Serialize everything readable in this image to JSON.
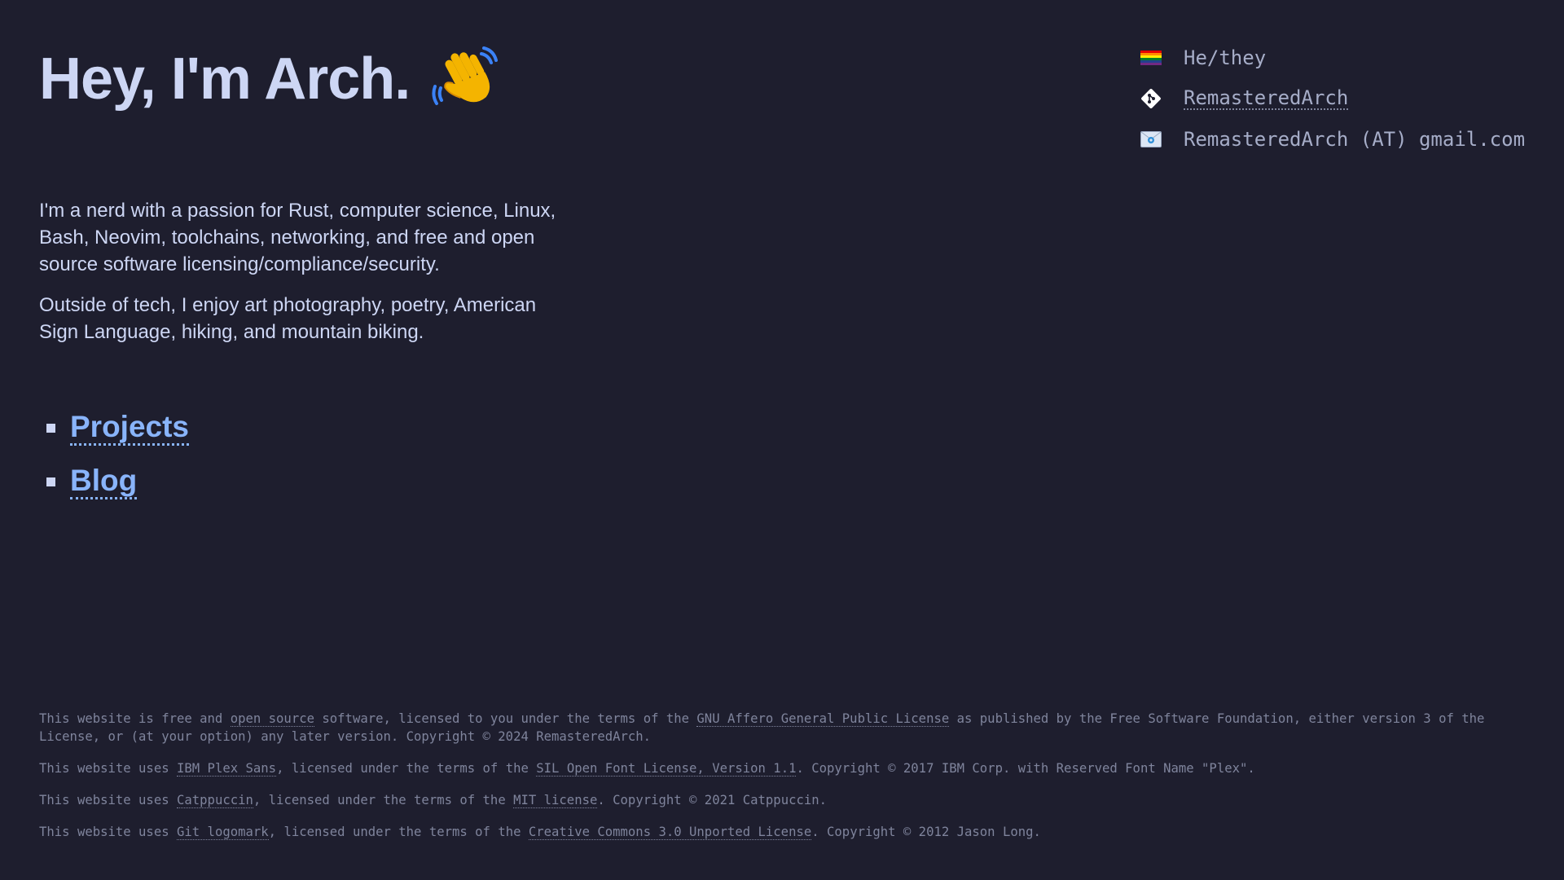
{
  "hero": {
    "title": "Hey, I'm Arch."
  },
  "intro": {
    "paragraph1": "I'm a nerd with a passion for Rust, computer science, Linux, Bash, Neovim, toolchains, networking, and free and open source software licensing/compliance/security.",
    "paragraph2": "Outside of tech, I enjoy art photography, poetry, American Sign Language, hiking, and mountain biking."
  },
  "nav": {
    "projects": "Projects",
    "blog": "Blog"
  },
  "info": {
    "pronouns": "He/they",
    "git_username": "RemasteredArch",
    "email": "RemasteredArch (AT) gmail.com",
    "icons": [
      "pride-flag-icon",
      "git-logo-icon",
      "email-icon"
    ]
  },
  "footer": {
    "line1": {
      "t1": "This website is free and ",
      "l1": "open source",
      "t2": " software, licensed to you under the terms of the ",
      "l2": "GNU Affero General Public License",
      "t3": " as published by the Free Software Foundation, either version 3 of the License, or (at your option) any later version. Copyright © 2024 RemasteredArch."
    },
    "line2": {
      "t1": "This website uses ",
      "l1": "IBM Plex Sans",
      "t2": ", licensed under the terms of the ",
      "l2": "SIL Open Font License, Version 1.1",
      "t3": ". Copyright © 2017 IBM Corp. with Reserved Font Name \"Plex\"."
    },
    "line3": {
      "t1": "This website uses ",
      "l1": "Catppuccin",
      "t2": ", licensed under the terms of the ",
      "l2": "MIT license",
      "t3": ". Copyright © 2021 Catppuccin."
    },
    "line4": {
      "t1": "This website uses ",
      "l1": "Git logomark",
      "t2": ", licensed under the terms of the ",
      "l2": "Creative Commons 3.0 Unported License",
      "t3": ". Copyright © 2012 Jason Long."
    }
  },
  "colors": {
    "background": "#1e1e2e",
    "text": "#cdd6f4",
    "link": "#89b4fa",
    "muted": "#7f849c"
  }
}
